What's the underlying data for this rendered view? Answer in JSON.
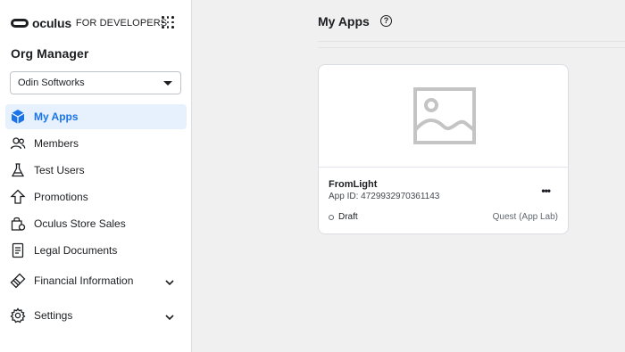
{
  "brand": {
    "name": "oculus",
    "suffix": "FOR DEVELOPERS"
  },
  "sidebar": {
    "title": "Org Manager",
    "org_selector": {
      "value": "Odin Softworks"
    },
    "items": [
      {
        "label": "My Apps",
        "icon": "cube-icon",
        "active": true
      },
      {
        "label": "Members",
        "icon": "people-icon"
      },
      {
        "label": "Test Users",
        "icon": "flask-icon"
      },
      {
        "label": "Promotions",
        "icon": "arrow-up-icon"
      },
      {
        "label": "Oculus Store Sales",
        "icon": "shopping-bag-icon"
      },
      {
        "label": "Legal Documents",
        "icon": "document-icon"
      },
      {
        "label": "Financial Information",
        "icon": "credit-card-icon",
        "expandable": true
      },
      {
        "label": "Settings",
        "icon": "gear-icon",
        "expandable": true
      }
    ]
  },
  "main": {
    "title": "My Apps",
    "apps": [
      {
        "name": "FromLight",
        "app_id": "App ID: 4729932970361143",
        "status": "Draft",
        "platform": "Quest (App Lab)",
        "thumbnail_icon": "image-placeholder-icon"
      }
    ]
  },
  "colors": {
    "accent": "#1a73e8",
    "active_bg": "#e7f1fd"
  }
}
